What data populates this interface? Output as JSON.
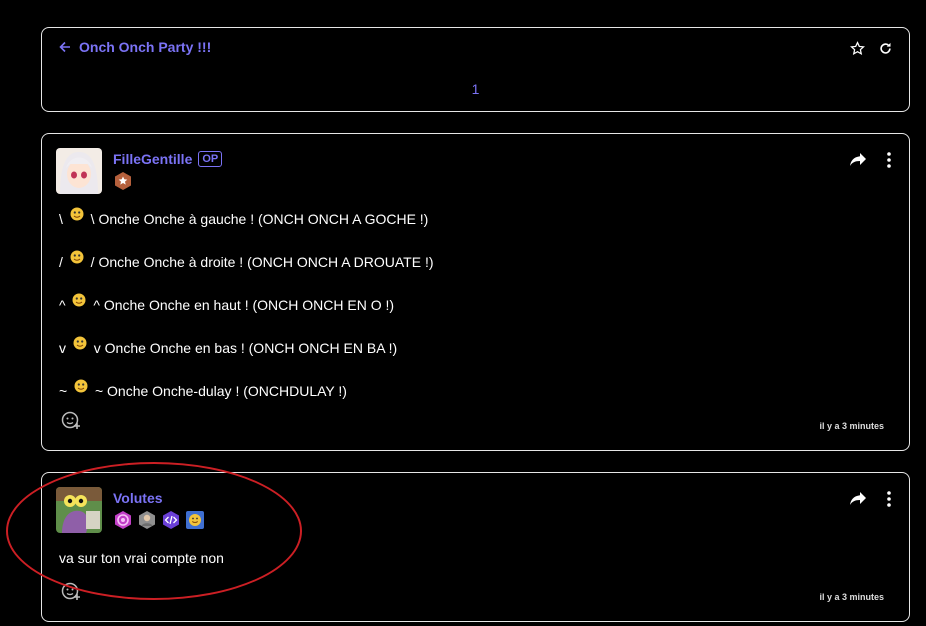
{
  "topic": {
    "title": "Onch Onch Party !!!",
    "page": "1",
    "icons": [
      "back-arrow-icon",
      "star-icon",
      "refresh-icon"
    ]
  },
  "posts": [
    {
      "username": "FilleGentille",
      "op_label": "OP",
      "lines": [
        {
          "pre": "\\ ",
          "post": " \\ Onche Onche à gauche ! (ONCH ONCH A GOCHE !)"
        },
        {
          "pre": "/ ",
          "post": " / Onche Onche à droite ! (ONCH ONCH A DROUATE !)"
        },
        {
          "pre": "^ ",
          "post": " ^ Onche Onche en haut ! (ONCH ONCH EN O !)"
        },
        {
          "pre": "v ",
          "post": " v Onche Onche en bas ! (ONCH ONCH EN BA !)"
        },
        {
          "pre": "~ ",
          "post": " ~ Onche Onche-dulay ! (ONCHDULAY !)"
        }
      ],
      "time": "il y a 3 minutes"
    },
    {
      "username": "Volutes",
      "text": "va sur ton vrai compte non",
      "time": "il y a 3 minutes"
    }
  ],
  "colors": {
    "accent": "#7b73f5",
    "annotation": "#cc1f24",
    "border": "#e6e6e6"
  }
}
